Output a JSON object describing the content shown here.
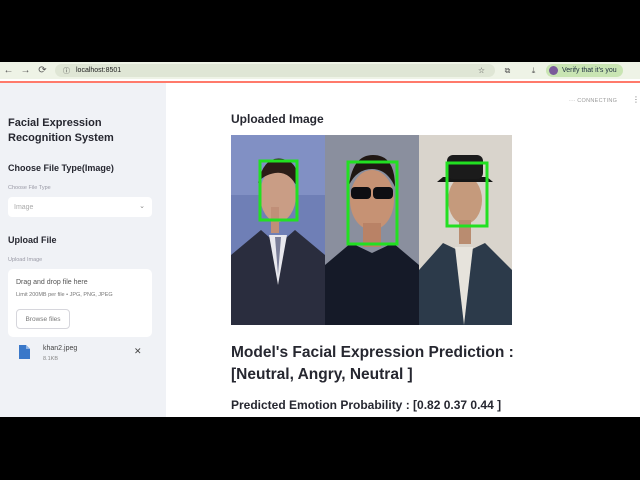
{
  "browser": {
    "url": "localhost:8501",
    "verify_label": "Verify that it's you",
    "back_glyph": "←",
    "forward_glyph": "→",
    "reload_glyph": "⟳",
    "lock_glyph": "ⓘ",
    "star_glyph": "☆",
    "extensions_glyph": "⧉",
    "download_glyph": "⤓"
  },
  "sidebar": {
    "title": "Facial Expression Recognition System",
    "file_type_heading": "Choose File Type(Image)",
    "file_type_label": "Choose File Type",
    "file_type_value": "Image",
    "upload_heading": "Upload File",
    "upload_label": "Upload Image",
    "dropzone_text": "Drag and drop file here",
    "dropzone_limit": "Limit 200MB per file • JPG, PNG, JPEG",
    "browse_label": "Browse files",
    "uploaded_file": {
      "name": "khan2.jpeg",
      "size": "8.1KB"
    },
    "chevron_glyph": "⌄",
    "close_glyph": "✕"
  },
  "main": {
    "status": "CONNECTING",
    "status_glyph": "···",
    "menu_glyph": "⋮",
    "uploaded_heading": "Uploaded Image",
    "prediction_heading": "Model's Facial Expression Prediction : [Neutral, Angry, Neutral ]",
    "probability_heading": "Predicted Emotion Probability : [0.82 0.37 0.44 ]"
  },
  "colors": {
    "sidebar_bg": "#f0f2f6",
    "face_box": "#22e022",
    "accent_line": "#ff7a6b"
  }
}
